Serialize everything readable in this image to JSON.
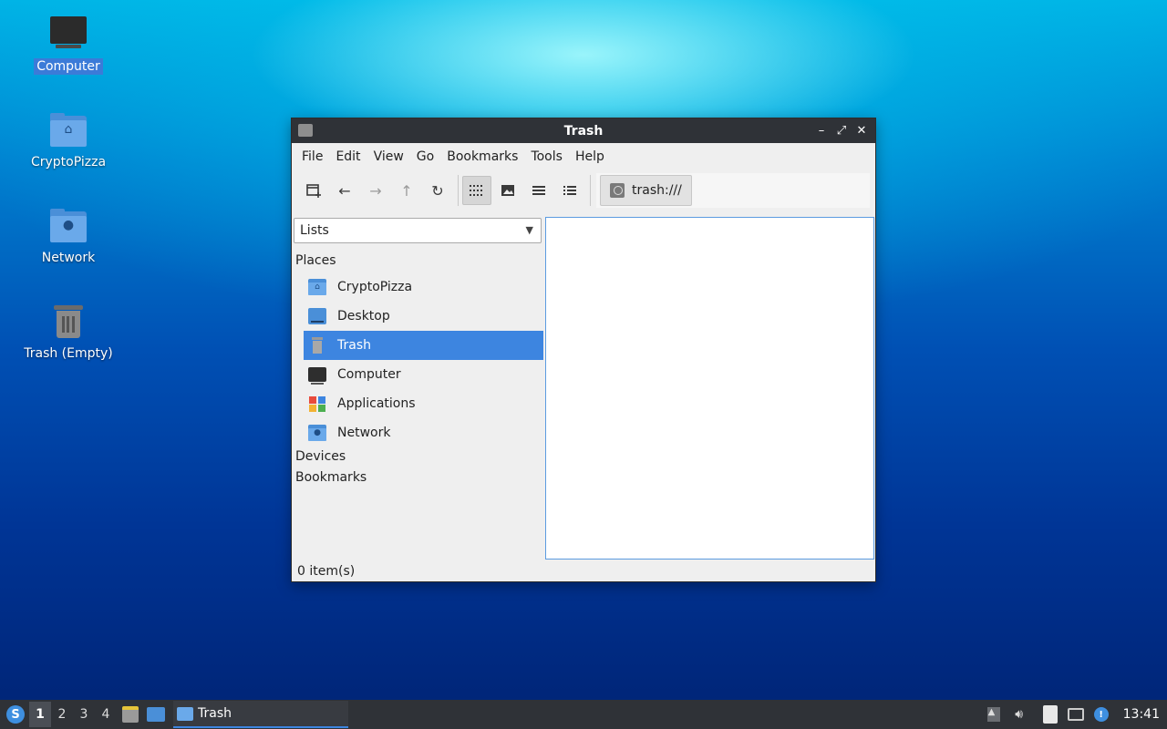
{
  "desktop": {
    "icons": [
      {
        "label": "Computer"
      },
      {
        "label": "CryptoPizza"
      },
      {
        "label": "Network"
      },
      {
        "label": "Trash (Empty)"
      }
    ]
  },
  "window": {
    "title": "Trash",
    "menu": [
      "File",
      "Edit",
      "View",
      "Go",
      "Bookmarks",
      "Tools",
      "Help"
    ],
    "toolbar": {
      "icons": [
        "new-tab-icon",
        "back-icon",
        "forward-icon",
        "up-icon",
        "reload-icon",
        "icon-view-icon",
        "thumbnail-view-icon",
        "compact-view-icon",
        "detailed-view-icon"
      ]
    },
    "path": "trash:///",
    "sidebar": {
      "mode": "Lists",
      "places_header": "Places",
      "places": [
        {
          "label": "CryptoPizza",
          "icon": "home-folder-icon"
        },
        {
          "label": "Desktop",
          "icon": "desktop-icon"
        },
        {
          "label": "Trash",
          "icon": "trash-icon",
          "selected": true
        },
        {
          "label": "Computer",
          "icon": "computer-icon"
        },
        {
          "label": "Applications",
          "icon": "applications-icon"
        },
        {
          "label": "Network",
          "icon": "network-folder-icon"
        }
      ],
      "devices_header": "Devices",
      "bookmarks_header": "Bookmarks"
    },
    "status": "0 item(s)"
  },
  "taskbar": {
    "workspaces": [
      "1",
      "2",
      "3",
      "4"
    ],
    "active_workspace": "1",
    "task_label": "Trash",
    "clock": "13:41"
  },
  "colors": {
    "accent": "#3d85e0",
    "titlebar": "#2f3237",
    "taskbar": "#2f3237"
  }
}
